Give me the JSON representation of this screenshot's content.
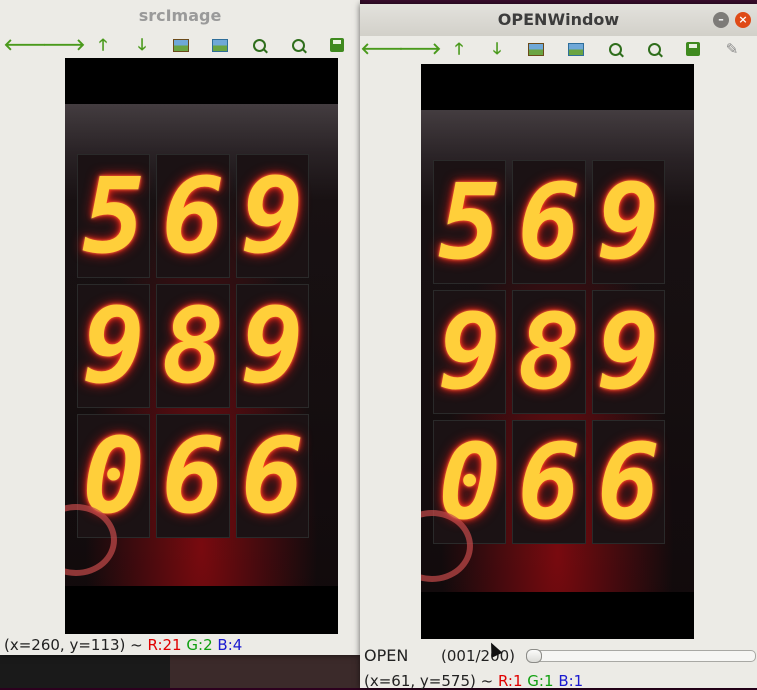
{
  "colors": {
    "window_bg": "#ecebe6",
    "close_button": "#df4a16",
    "status_r": "#e00000",
    "status_g": "#11a011",
    "status_b": "#1a1ad0",
    "segment_glow": "#ffcf3a"
  },
  "display_digits": [
    "5",
    "6",
    "9",
    "9",
    "8",
    "9",
    "0",
    "6",
    "6"
  ],
  "src_window": {
    "title": "srcImage",
    "toolbar": [
      {
        "icon": "pan-left-icon"
      },
      {
        "icon": "pan-right-icon"
      },
      {
        "icon": "pan-up-icon"
      },
      {
        "icon": "pan-down-icon"
      },
      {
        "icon": "zoom-original-icon"
      },
      {
        "icon": "zoom-fit-icon"
      },
      {
        "icon": "zoom-in-icon"
      },
      {
        "icon": "zoom-out-icon"
      },
      {
        "icon": "save-icon"
      }
    ],
    "status": {
      "coords": "(x=260, y=113) ~ ",
      "r": "R:21",
      "g": "G:2",
      "b": "B:4"
    }
  },
  "open_window": {
    "title": "OPENWindow",
    "minimize_glyph": "–",
    "close_glyph": "×",
    "toolbar": [
      {
        "icon": "pan-left-icon"
      },
      {
        "icon": "pan-right-icon"
      },
      {
        "icon": "pan-up-icon"
      },
      {
        "icon": "pan-down-icon"
      },
      {
        "icon": "zoom-original-icon"
      },
      {
        "icon": "zoom-fit-icon"
      },
      {
        "icon": "zoom-in-icon"
      },
      {
        "icon": "zoom-out-icon"
      },
      {
        "icon": "save-icon"
      },
      {
        "icon": "properties-icon"
      }
    ],
    "trackbar": {
      "label": "OPEN",
      "value_text": "(001/200)",
      "value": 1,
      "max": 200
    },
    "status": {
      "coords": "(x=61, y=575) ~ ",
      "r": "R:1",
      "g": "G:1",
      "b": "B:1"
    }
  }
}
